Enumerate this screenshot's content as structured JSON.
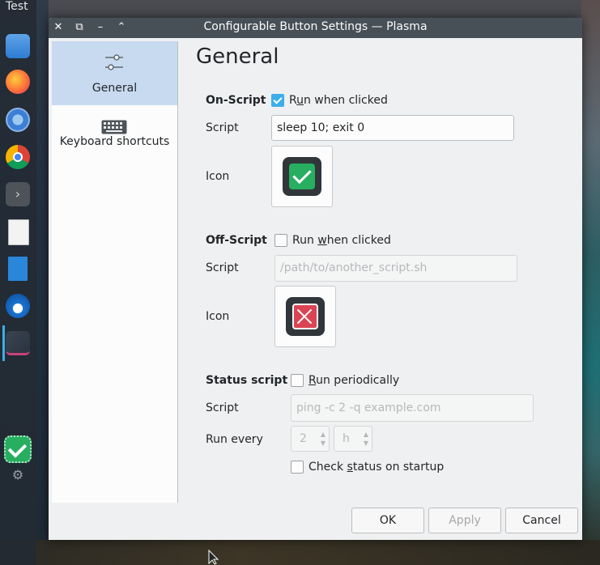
{
  "desktop": {
    "panel_title": "Test",
    "dock_icons": [
      "folder-icon",
      "firefox-icon",
      "chromium-icon",
      "chrome-icon",
      "terminal-icon",
      "text-editor-icon",
      "document-icon",
      "thunderbird-icon",
      "ide-icon",
      "configurable-button-icon",
      "settings-gear-icon"
    ]
  },
  "window": {
    "title": "Configurable Button Settings — Plasma",
    "titlebar_buttons": [
      "close-icon",
      "restore-icon",
      "minimize-icon",
      "keep-above-icon"
    ]
  },
  "sidebar": {
    "items": [
      {
        "label": "General",
        "icon": "sliders-icon",
        "selected": true
      },
      {
        "label": "Keyboard shortcuts",
        "icon": "keyboard-icon",
        "selected": false
      }
    ]
  },
  "general": {
    "page_title": "General",
    "on_script": {
      "section_label": "On-Script",
      "checkbox_checked": true,
      "checkbox_label_pre": "R",
      "checkbox_label_mnemonic": "u",
      "checkbox_label_post": "n when clicked",
      "script_label": "Script",
      "script_value": "sleep 10; exit 0",
      "icon_label": "Icon",
      "icon_color": "#27ae60",
      "icon": "check-icon"
    },
    "off_script": {
      "section_label": "Off-Script",
      "checkbox_checked": false,
      "checkbox_label_pre": "Run ",
      "checkbox_label_mnemonic": "w",
      "checkbox_label_post": "hen clicked",
      "script_label": "Script",
      "script_placeholder": "/path/to/another_script.sh",
      "icon_label": "Icon",
      "icon_color": "#da4453",
      "icon": "x-icon"
    },
    "status_script": {
      "section_label": "Status script",
      "checkbox_checked": false,
      "checkbox_label_mnemonic": "R",
      "checkbox_label_post": "un periodically",
      "script_label": "Script",
      "script_placeholder": "ping -c 2 -q example.com",
      "run_every_label": "Run every",
      "run_every_value": "2",
      "run_every_unit": "h",
      "startup_checkbox_checked": false,
      "startup_label_pre": "Check ",
      "startup_label_mnemonic": "s",
      "startup_label_post": "tatus on startup"
    }
  },
  "buttons": {
    "ok": "OK",
    "apply": "Apply",
    "cancel": "Cancel"
  }
}
